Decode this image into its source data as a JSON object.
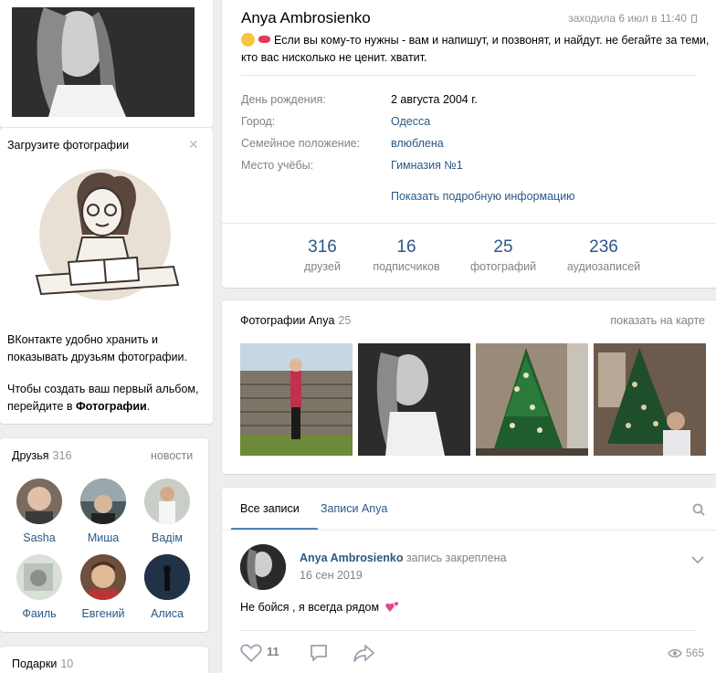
{
  "upload_photos": {
    "title": "Загрузите фотографии",
    "text1": "ВКонтакте удобно хранить и показывать друзьям фотографии.",
    "text2_prefix": "Чтобы создать ваш первый альбом, перейдите в ",
    "text2_link": "Фотографии",
    "text2_suffix": "."
  },
  "friends": {
    "title": "Друзья",
    "count": "316",
    "news_link": "новости",
    "items": [
      {
        "name": "Sasha"
      },
      {
        "name": "Миша"
      },
      {
        "name": "Вадім"
      },
      {
        "name": "Фаиль"
      },
      {
        "name": "Евгений"
      },
      {
        "name": "Алиса"
      }
    ]
  },
  "gifts": {
    "title": "Подарки",
    "count": "10"
  },
  "profile": {
    "name": "Anya Ambrosienko",
    "last_seen": "заходила 6 июл в 11:40",
    "status": "Если вы кому-то нужны - вам и напишут, и позвонят, и найдут. не бегайте за теми, кто вас нисколько не ценит. хватит.",
    "info": [
      {
        "label": "День рождения:",
        "value": "2 августа 2004 г."
      },
      {
        "label": "Город:",
        "value": "Одесса"
      },
      {
        "label": "Семейное положение:",
        "value": "влюблена"
      },
      {
        "label": "Место учёбы:",
        "value": "Гимназия №1"
      }
    ],
    "more_info": "Показать подробную информацию",
    "counters": [
      {
        "num": "316",
        "label": "друзей"
      },
      {
        "num": "16",
        "label": "подписчиков"
      },
      {
        "num": "25",
        "label": "фотографий"
      },
      {
        "num": "236",
        "label": "аудиозаписей"
      }
    ]
  },
  "photos": {
    "title": "Фотографии Anya",
    "count": "25",
    "map_link": "показать на карте"
  },
  "wall": {
    "tab_all": "Все записи",
    "tab_own": "Записи Anya",
    "post": {
      "author": "Anya Ambrosienko",
      "pinned": "запись закреплена",
      "date": "16 сен 2019",
      "text": "Не бойся , я всегда рядом",
      "likes": "11",
      "views": "565"
    }
  },
  "colors": {
    "accent": "#2a5885",
    "muted": "#828282",
    "background": "#edeef0",
    "like": "#5181b8"
  },
  "icons": [
    "close-icon",
    "phone-icon",
    "search-icon",
    "chevron-down-icon",
    "heart-icon",
    "comment-icon",
    "share-icon",
    "eye-icon",
    "emoji-icon",
    "hearts-emoji-icon"
  ]
}
